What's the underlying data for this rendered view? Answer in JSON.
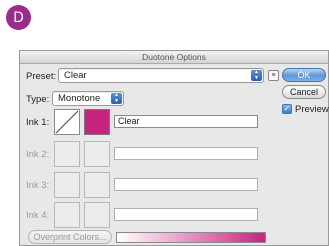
{
  "badge": {
    "letter": "D"
  },
  "dialog": {
    "title": "Duotone Options",
    "preset": {
      "label": "Preset:",
      "value": "Clear"
    },
    "type": {
      "label": "Type:",
      "value": "Monotone"
    },
    "inks": [
      {
        "label": "Ink 1:",
        "name": "Clear",
        "enabled": true,
        "color": "#c8237f"
      },
      {
        "label": "Ink 2:",
        "name": "",
        "enabled": false
      },
      {
        "label": "Ink 3:",
        "name": "",
        "enabled": false
      },
      {
        "label": "Ink 4:",
        "name": "",
        "enabled": false
      }
    ],
    "buttons": {
      "ok": "OK",
      "cancel": "Cancel",
      "overprint": "Overprint Colors..."
    },
    "preview": {
      "label": "Preview",
      "checked": true
    },
    "gradient": {
      "from": "#ffffff",
      "to": "#c8237f"
    }
  }
}
